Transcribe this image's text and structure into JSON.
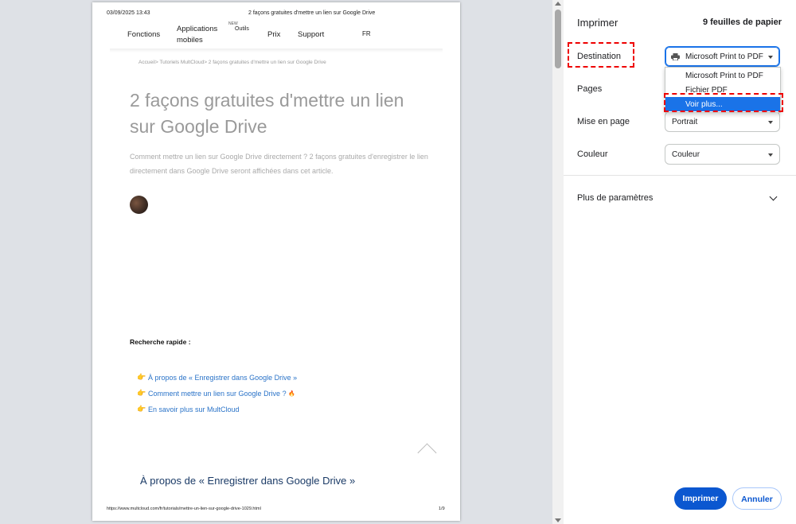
{
  "preview": {
    "header_date": "03/09/2025 13:43",
    "header_title": "2 façons gratuites d'mettre un lien sur Google Drive",
    "nav": {
      "fonctions": "Fonctions",
      "apps_line1": "Applications",
      "apps_line2": "mobiles",
      "new_badge": "NEW",
      "outils": "Outils",
      "prix": "Prix",
      "support": "Support",
      "lang": "FR"
    },
    "breadcrumb": "Accueil> Tutoriels MultCloud> 2 façons gratuites d'mettre un lien sur Google Drive",
    "article_title": "2 façons gratuites d'mettre un lien sur Google Drive",
    "description": "Comment mettre un lien sur Google Drive directement ? 2 façons gratuites d'enregistrer le lien directement dans Google Drive seront affichées dans cet article.",
    "quick_search": "Recherche rapide :",
    "links": [
      "À propos de « Enregistrer dans Google Drive »",
      "Comment mettre un lien sur Google Drive ?",
      "En savoir plus sur MultCloud"
    ],
    "hand_icon": "👉",
    "fire_icon": "🔥",
    "section_heading": "À propos de « Enregistrer dans Google Drive »",
    "footer_url": "https://www.multcloud.com/fr/tutorials/mettre-un-lien-sur-google-drive-1029.html",
    "footer_page": "1/9"
  },
  "panel": {
    "title": "Imprimer",
    "sheets": "9 feuilles de papier",
    "destination_label": "Destination",
    "destination_value": "Microsoft Print to PDF",
    "destination_options": [
      "Microsoft Print to PDF",
      "Fichier PDF",
      "Voir plus..."
    ],
    "pages_label": "Pages",
    "layout_label": "Mise en page",
    "layout_value": "Portrait",
    "color_label": "Couleur",
    "color_value": "Couleur",
    "more_settings": "Plus de paramètres",
    "print_button": "Imprimer",
    "cancel_button": "Annuler"
  },
  "colors": {
    "accent": "#0b57d0",
    "selected_option": "#1a73e8",
    "annotation_red": "#e00000",
    "link": "#2a73c8"
  }
}
